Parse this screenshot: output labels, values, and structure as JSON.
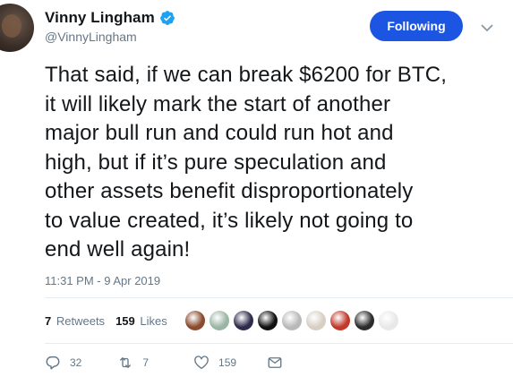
{
  "tweet": {
    "author": {
      "display_name": "Vinny Lingham",
      "handle": "@VinnyLingham",
      "verified": true
    },
    "follow_button_label": "Following",
    "text": "That said, if we can break $6200 for BTC,\nit will likely mark the start of another\nmajor bull run and could run hot and\nhigh, but if it’s pure speculation and\nother assets benefit disproportionately\nto value created, it’s likely not going to\nend well again!",
    "timestamp": "11:31 PM - 9 Apr 2019",
    "stats": {
      "retweets_count": "7",
      "retweets_label": "Retweets",
      "likes_count": "159",
      "likes_label": "Likes"
    },
    "likers": [
      {
        "name": "liker-avatar-1",
        "color": "#8a4b2e"
      },
      {
        "name": "liker-avatar-2",
        "color": "#9bb5a5"
      },
      {
        "name": "liker-avatar-3",
        "color": "#2e2a4a"
      },
      {
        "name": "liker-avatar-4",
        "color": "#111111"
      },
      {
        "name": "liker-avatar-5",
        "color": "#b9b9b9"
      },
      {
        "name": "liker-avatar-6",
        "color": "#d8cfc4"
      },
      {
        "name": "liker-avatar-7",
        "color": "#c0392b"
      },
      {
        "name": "liker-avatar-8",
        "color": "#2c2c2c"
      },
      {
        "name": "liker-avatar-9",
        "color": "#e8e8e8"
      }
    ],
    "actions": {
      "reply_count": "32",
      "retweet_count": "7",
      "like_count": "159"
    }
  },
  "colors": {
    "accent": "#1b55e2",
    "verified": "#1da1f2",
    "text": "#14171a",
    "muted": "#657786",
    "divider": "#e6ecf0"
  },
  "icons": {
    "verified": "verified-badge-icon",
    "caret": "chevron-down-icon",
    "reply": "reply-icon",
    "retweet": "retweet-icon",
    "like": "heart-icon",
    "dm": "envelope-icon"
  }
}
